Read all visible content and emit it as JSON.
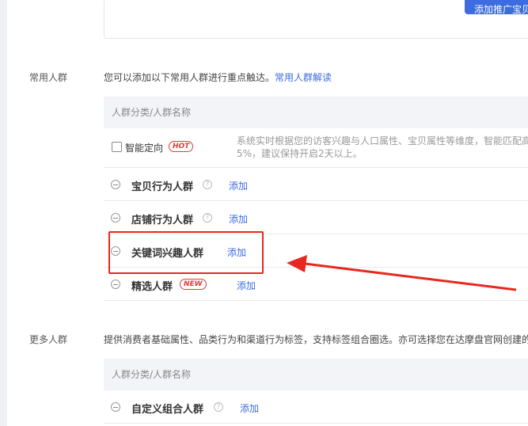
{
  "top": {
    "add_button_label": "添加推广宝贝"
  },
  "common": {
    "section_label": "常用人群",
    "desc": "您可以添加以下常用人群进行重点触达。",
    "desc_link": "常用人群解读",
    "table_header": "人群分类/人群名称",
    "smart": {
      "label": "智能定向",
      "badge": "HOT",
      "desc": "系统实时根据您的访客兴趣与人口属性、宝贝属性等维度，智能匹配高5%，建议保持开启2天以上。"
    },
    "rows": [
      {
        "label": "宝贝行为人群",
        "add": "添加",
        "help": "?"
      },
      {
        "label": "店铺行为人群",
        "add": "添加",
        "help": "?"
      },
      {
        "label": "关键词兴趣人群",
        "add": "添加"
      },
      {
        "label": "精选人群",
        "badge": "NEW",
        "add": "添加"
      }
    ]
  },
  "more": {
    "section_label": "更多人群",
    "desc": "提供消费者基础属性、品类行为和渠道行为标签，支持标签组合圈选。亦可选择您在达摩盘官网创建的",
    "table_header": "人群分类/人群名称",
    "rows": [
      {
        "label": "自定义组合人群",
        "add": "添加",
        "help": "?"
      }
    ]
  },
  "colors": {
    "accent": "#3d6be0",
    "annotation": "#e8271f",
    "badge": "#e23a3a"
  }
}
